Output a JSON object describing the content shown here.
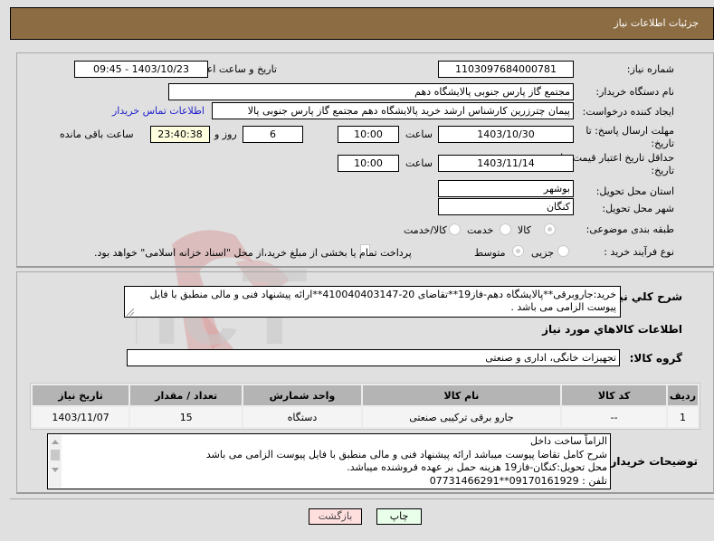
{
  "header": {
    "title": "جزئیات اطلاعات نیاز"
  },
  "form": {
    "need_number": {
      "label": "شماره نیاز:",
      "value": "1103097684000781"
    },
    "announce_datetime": {
      "label": "تاریخ و ساعت اعلان عمومی:",
      "value": "1403/10/23 - 09:45"
    },
    "buyer_org": {
      "label": "نام دستگاه خریدار:",
      "value": "مجتمع گاز پارس جنوبی  پالایشگاه دهم"
    },
    "creator": {
      "label": "ایجاد کننده درخواست:",
      "value": "پیمان چترزرین کارشناس ارشد خرید پالایشگاه دهم مجتمع گاز پارس جنوبی  پالا"
    },
    "buyer_contact_link": "اطلاعات تماس خریدار",
    "response_deadline": {
      "label_line1": "مهلت ارسال پاسخ: تا",
      "label_line2": "تاریخ:",
      "date": "1403/10/30",
      "time_label": "ساعت",
      "time": "10:00",
      "days": "6",
      "days_label": "روز و",
      "remaining": "23:40:38",
      "remaining_label": "ساعت باقی مانده"
    },
    "price_validity": {
      "label_line1": "حداقل تاریخ اعتبار قیمت: تا",
      "label_line2": "تاریخ:",
      "date": "1403/11/14",
      "time_label": "ساعت",
      "time": "10:00"
    },
    "delivery_province": {
      "label": "استان محل تحویل:",
      "value": "بوشهر"
    },
    "delivery_city": {
      "label": "شهر محل تحویل:",
      "value": "کنگان"
    },
    "category": {
      "label": "طبقه بندی موضوعی:",
      "options": [
        "کالا",
        "خدمت",
        "کالا/خدمت"
      ],
      "selected": "کالا"
    },
    "purchase_process": {
      "label": "نوع فرآیند خرید :",
      "options": [
        "جزیی",
        "متوسط"
      ],
      "selected": "متوسط",
      "treasury_checkbox_label": "پرداخت تمام یا بخشی از مبلغ خرید،از محل \"اسناد خزانه اسلامی\" خواهد بود.",
      "treasury_checked": false
    }
  },
  "description": {
    "label": "شرح کلي نياز:",
    "value": "خرید:جاروبرقی**پالایشگاه دهم-فاز19**تقاضای 20-410040403147**ارائه پیشنهاد فنی و مالی منطبق با فایل پیوست الزامی می باشد ."
  },
  "goods_section": {
    "title": "اطلاعات کالاهاي مورد نياز",
    "group_label": "گروه کالا:",
    "group_value": "تجهیزات خانگی، اداری و صنعتی",
    "table": {
      "columns": [
        "ردیف",
        "کد کالا",
        "نام کالا",
        "واحد شمارش",
        "تعداد / مقدار",
        "تاریخ نیاز"
      ],
      "rows": [
        [
          "1",
          "--",
          "جارو برقی ترکیبی صنعتی",
          "دستگاه",
          "15",
          "1403/11/07"
        ]
      ]
    }
  },
  "buyer_notes": {
    "label": "توضیحات خریدار:",
    "lines": [
      "الزاماً ساخت داخل",
      "شرح کامل تقاضا پیوست میباشد ارائه پیشنهاد فنی و مالی منطبق با فایل پیوست الزامی می باشد",
      "محل تحویل:کنگان-فاز19 هزینه حمل بر عهده فروشنده میباشد.",
      "تلفن : 09170161929**07731466291"
    ]
  },
  "buttons": {
    "print": "چاپ",
    "back": "بازگشت"
  },
  "colors": {
    "header_bg": "#8c6d43",
    "link": "#2222cc",
    "print_bg": "#eaffea",
    "back_bg": "#ffdede"
  }
}
